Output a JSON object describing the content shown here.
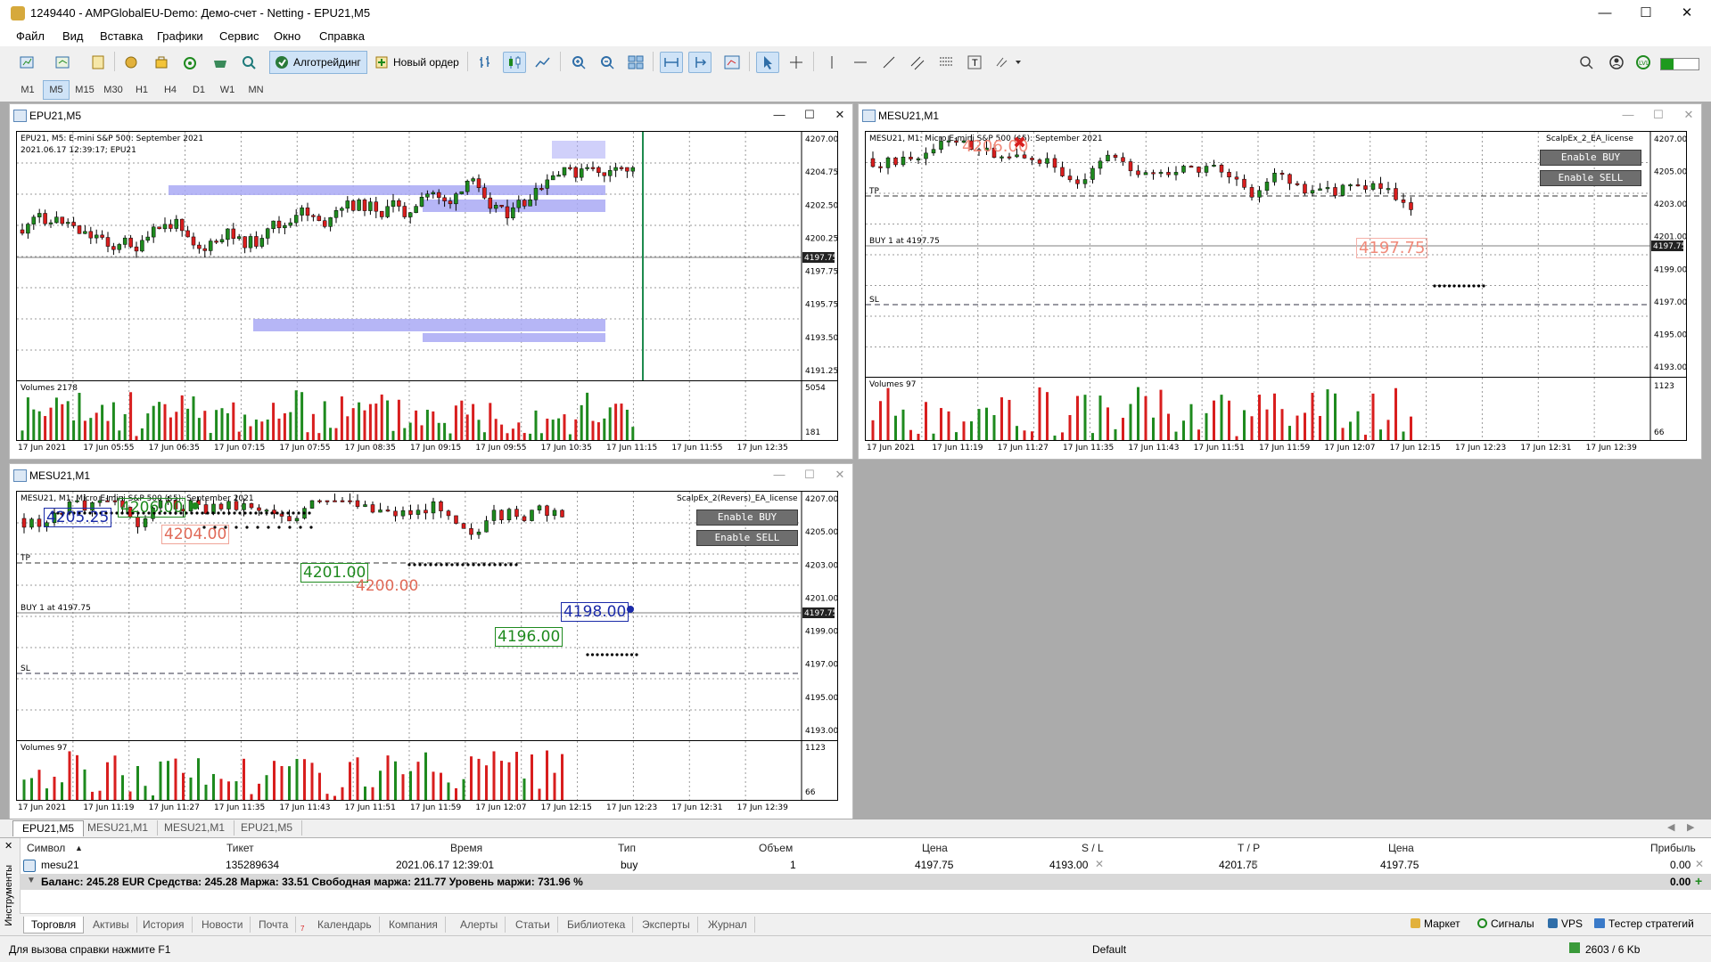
{
  "window": {
    "title": "1249440 - AMPGlobalEU-Demo: Демо-счет - Netting - EPU21,M5"
  },
  "menu": [
    "Файл",
    "Вид",
    "Вставка",
    "Графики",
    "Сервис",
    "Окно",
    "Справка"
  ],
  "toolbar": {
    "algo_label": "Алготрейдинг",
    "new_order_label": "Новый ордер"
  },
  "timeframes": [
    "M1",
    "M5",
    "M15",
    "M30",
    "H1",
    "H4",
    "D1",
    "W1",
    "MN"
  ],
  "active_timeframe": "M5",
  "charts": {
    "epu": {
      "caption": "EPU21,M5",
      "header": "EPU21, M5: E-mini S&P 500: September 2021",
      "datetime": "2021.06.17 12:39:17; EPU21",
      "price_ticks": [
        "4207.00",
        "4204.75",
        "4202.50",
        "4200.25",
        "4197.75",
        "4195.75",
        "4193.50",
        "4191.25"
      ],
      "current_price": "4197.75",
      "volume_label": "Volumes 2178",
      "volume_ticks": [
        "5054",
        "181"
      ],
      "time_labels": [
        "17 Jun 2021",
        "17 Jun 05:55",
        "17 Jun 06:35",
        "17 Jun 07:15",
        "17 Jun 07:55",
        "17 Jun 08:35",
        "17 Jun 09:15",
        "17 Jun 09:55",
        "17 Jun 10:35",
        "17 Jun 11:15",
        "17 Jun 11:55",
        "17 Jun 12:35"
      ]
    },
    "mesu_right": {
      "caption": "MESU21,M1",
      "header": "MESU21, M1: Micro E-mini S&P 500 ($5): September 2021",
      "ea_label": "ScalpEx_2_EA_license",
      "enable_buy": "Enable BUY",
      "enable_sell": "Enable SELL",
      "tp_label": "TP",
      "sl_label": "SL",
      "buy_label": "BUY 1 at 4197.75",
      "marker_4206": "4206.00",
      "marker_4197": "4197.75",
      "price_ticks": [
        "4207.00",
        "4205.00",
        "4203.00",
        "4201.00",
        "4199.00",
        "4197.00",
        "4195.00",
        "4193.00"
      ],
      "current_price": "4197.75",
      "volume_label": "Volumes 97",
      "volume_ticks": [
        "1123",
        "66"
      ],
      "time_labels": [
        "17 Jun 2021",
        "17 Jun 11:19",
        "17 Jun 11:27",
        "17 Jun 11:35",
        "17 Jun 11:43",
        "17 Jun 11:51",
        "17 Jun 11:59",
        "17 Jun 12:07",
        "17 Jun 12:15",
        "17 Jun 12:23",
        "17 Jun 12:31",
        "17 Jun 12:39"
      ]
    },
    "mesu_left": {
      "caption": "MESU21,M1",
      "header": "MESU21, M1: Micro E-mini S&P 500 ($5): September 2021",
      "ea_label": "ScalpEx_2(Revers)_EA_license",
      "enable_buy": "Enable BUY",
      "enable_sell": "Enable SELL",
      "tp_label": "TP",
      "sl_label": "SL",
      "buy_label": "BUY 1 at 4197.75",
      "m1": "4205.25",
      "m2": "4206.00",
      "m3": "4204.00",
      "m4": "4201.00",
      "m5": "4200.00",
      "m6": "4198.00",
      "m7": "4196.00",
      "price_ticks": [
        "4207.00",
        "4205.00",
        "4203.00",
        "4201.00",
        "4199.00",
        "4197.00",
        "4195.00",
        "4193.00"
      ],
      "current_price": "4197.75",
      "volume_label": "Volumes 97",
      "volume_ticks": [
        "1123",
        "66"
      ],
      "time_labels": [
        "17 Jun 2021",
        "17 Jun 11:19",
        "17 Jun 11:27",
        "17 Jun 11:35",
        "17 Jun 11:43",
        "17 Jun 11:51",
        "17 Jun 11:59",
        "17 Jun 12:07",
        "17 Jun 12:15",
        "17 Jun 12:23",
        "17 Jun 12:31",
        "17 Jun 12:39"
      ]
    }
  },
  "chart_tabs": [
    "EPU21,M5",
    "MESU21,M1",
    "MESU21,M1",
    "EPU21,M5"
  ],
  "toolbox": {
    "side_label": "Инструменты",
    "columns": [
      "Символ",
      "Тикет",
      "Время",
      "Тип",
      "Объем",
      "Цена",
      "S / L",
      "T / P",
      "Цена",
      "Прибыль"
    ],
    "row": {
      "symbol": "mesu21",
      "ticket": "135289634",
      "time": "2021.06.17 12:39:01",
      "type": "buy",
      "volume": "1",
      "open_price": "4197.75",
      "sl": "4193.00",
      "tp": "4201.75",
      "price": "4197.75",
      "profit": "0.00"
    },
    "balance_text": "Баланс: 245.28 EUR  Средства: 245.28  Маржа: 33.51  Свободная маржа: 211.77  Уровень маржи: 731.96 %",
    "balance_profit": "0.00",
    "tabs": [
      "Торговля",
      "Активы",
      "История",
      "Новости",
      "Почта",
      "Календарь",
      "Компания",
      "Алерты",
      "Статьи",
      "Библиотека",
      "Эксперты",
      "Журнал"
    ],
    "mail_badge": "7",
    "right_tabs": [
      "Маркет",
      "Сигналы",
      "VPS",
      "Тестер стратегий"
    ]
  },
  "status": {
    "help": "Для вызова справки нажмите F1",
    "profile": "Default",
    "traffic": "2603 / 6 Kb"
  },
  "colors": {
    "bull": "#1e8a1e",
    "bear": "#d81e1e",
    "zone": "#a9a9f5",
    "ea_button": "#6e6e6e"
  }
}
